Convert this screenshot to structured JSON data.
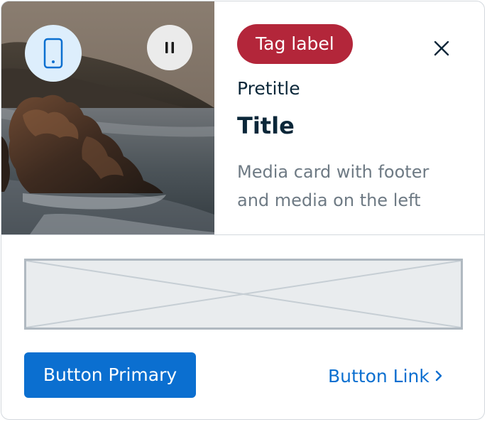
{
  "card": {
    "tag_label": "Tag label",
    "pretitle": "Pretitle",
    "title": "Title",
    "description": "Media card with footer and media on the left",
    "media": {
      "device_icon": "mobile-phone-icon",
      "pause_icon": "pause-icon",
      "image_subject": "coastal rocks at sunset"
    },
    "close_icon": "close-icon",
    "footer": {
      "placeholder_icon": "image-placeholder",
      "primary_button_label": "Button Primary",
      "link_button_label": "Button Link",
      "link_icon": "chevron-right-icon"
    }
  },
  "colors": {
    "tag_background": "#b3263a",
    "primary": "#0b6fd0",
    "title_text": "#0b2739",
    "description_text": "#6e7a84",
    "device_button_background": "#ddeefc",
    "pause_button_background": "#ebebeb"
  }
}
